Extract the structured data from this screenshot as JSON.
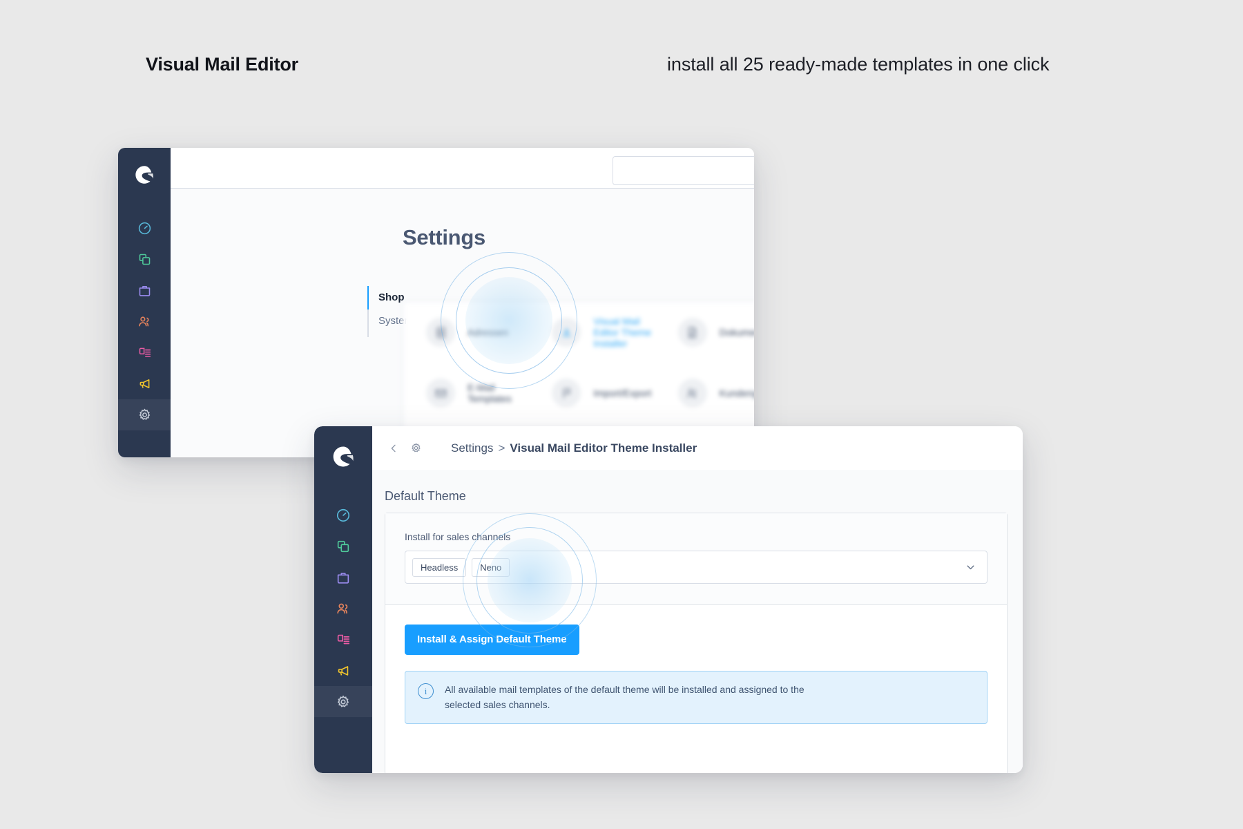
{
  "headline": {
    "left": "Visual Mail Editor",
    "right": "install all 25 ready-made templates in one click"
  },
  "colors": {
    "page_bg": "#e9e9e9",
    "sidebar": "#2b3850",
    "accent_blue": "#189eff",
    "link_blue": "#2ea8f5",
    "info_bg": "#e3f2fd",
    "info_border": "#9fd2f5"
  },
  "window_back": {
    "name": "Shopware Administration - Settings",
    "search_placeholder": "",
    "search_value": "",
    "page_title": "Settings",
    "subnav": [
      {
        "label": "Shop",
        "active": true
      },
      {
        "label": "System",
        "active": false
      }
    ],
    "settings_tiles": [
      {
        "label": "Adressen",
        "icon": "address-book-icon",
        "highlighted": false
      },
      {
        "label": "Visual Mail Editor Theme Installer",
        "icon": "download-icon",
        "highlighted": true
      },
      {
        "label": "Dokumente",
        "icon": "document-icon",
        "highlighted": false
      },
      {
        "label": "E-Mail Templates",
        "icon": "envelope-icon",
        "highlighted": false
      },
      {
        "label": "Import/Export",
        "icon": "flag-icon",
        "highlighted": false
      },
      {
        "label": "Kundengruppen",
        "icon": "users-icon",
        "highlighted": false
      }
    ],
    "sidebar_icons": [
      {
        "name": "shopware-logo-icon",
        "color": "#ffffff"
      },
      {
        "name": "dashboard-gauge-icon",
        "color": "#58b8d9"
      },
      {
        "name": "catalogues-icon",
        "color": "#4fc99a"
      },
      {
        "name": "orders-bag-icon",
        "color": "#9b8cf0"
      },
      {
        "name": "customers-icon",
        "color": "#e8845c"
      },
      {
        "name": "content-icon",
        "color": "#ea5ba4"
      },
      {
        "name": "marketing-megaphone-icon",
        "color": "#f2c52c"
      },
      {
        "name": "settings-gear-icon",
        "color": "#c3cad6"
      }
    ]
  },
  "window_front": {
    "name": "Visual Mail Editor Theme Installer",
    "breadcrumb": {
      "first": "Settings",
      "separator": ">",
      "current": "Visual Mail Editor Theme Installer"
    },
    "back_label": "Back",
    "section_title": "Default Theme",
    "field_label": "Install for sales channels",
    "sales_channels": [
      "Headless",
      "Neno"
    ],
    "install_button": "Install & Assign Default Theme",
    "info_text": "All available mail templates of the default theme will be installed and assigned to the selected sales channels.",
    "sidebar_icons": [
      {
        "name": "shopware-logo-icon",
        "color": "#ffffff"
      },
      {
        "name": "dashboard-gauge-icon",
        "color": "#58b8d9"
      },
      {
        "name": "catalogues-icon",
        "color": "#4fc99a"
      },
      {
        "name": "orders-bag-icon",
        "color": "#9b8cf0"
      },
      {
        "name": "customers-icon",
        "color": "#e8845c"
      },
      {
        "name": "content-icon",
        "color": "#ea5ba4"
      },
      {
        "name": "marketing-megaphone-icon",
        "color": "#f2c52c"
      },
      {
        "name": "settings-gear-icon",
        "color": "#c3cad6"
      }
    ]
  }
}
